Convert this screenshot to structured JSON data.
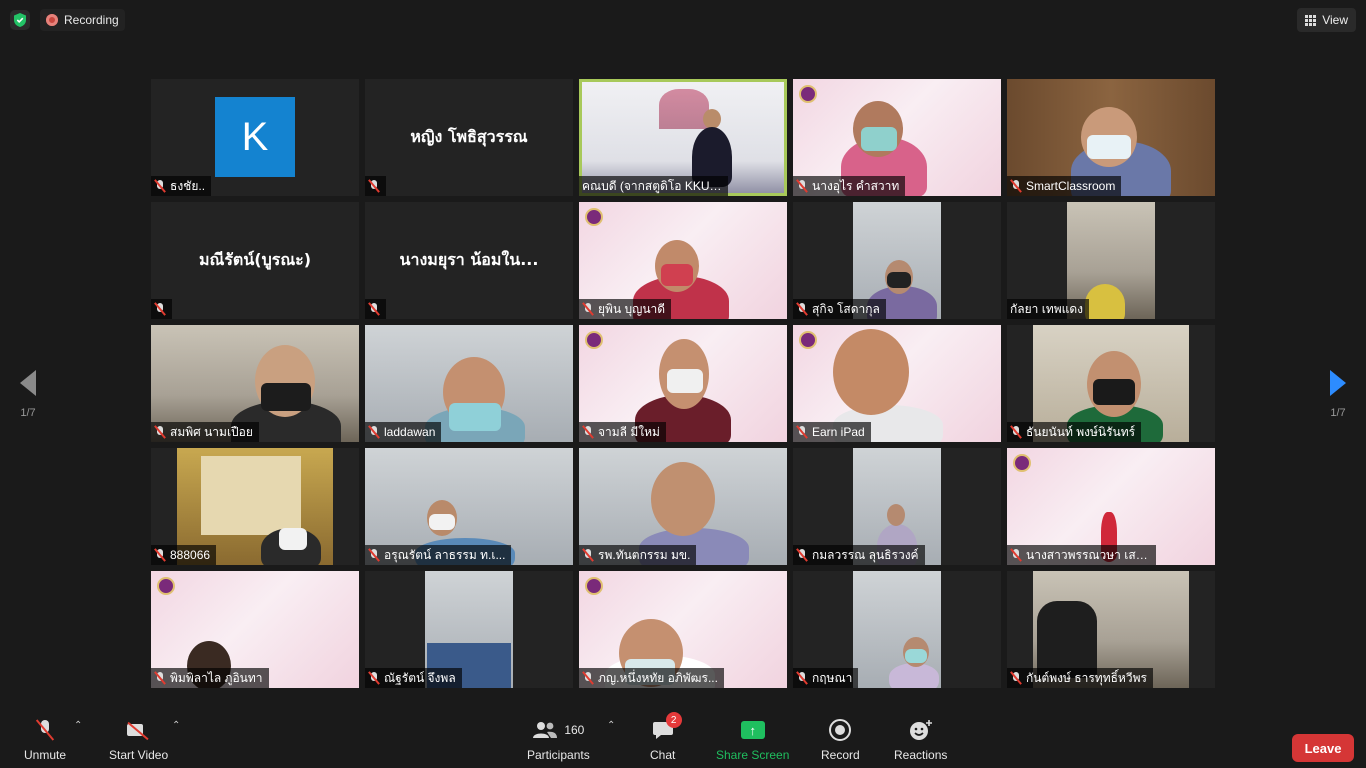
{
  "topbar": {
    "recording_label": "Recording",
    "view_label": "View"
  },
  "pagination": {
    "left": "1/7",
    "right": "1/7"
  },
  "tiles": [
    {
      "name": "ธงชัย..",
      "avatar": "K"
    },
    {
      "name": "",
      "big_name": "หญิง โพธิสุวรรณ"
    },
    {
      "name": "คณบดี (จากสตูดิโอ KKU ..."
    },
    {
      "name": "นางอุไร คำสวาท"
    },
    {
      "name": "SmartClassroom"
    },
    {
      "name": "",
      "big_name": "มณีรัตน์(บูรณะ)"
    },
    {
      "name": "",
      "big_name": "นางมยุรา น้อมใน..."
    },
    {
      "name": "ยุพิน บุญนาดี"
    },
    {
      "name": "สุกิจ โสดากุล"
    },
    {
      "name": "กัลยา เทพแดง"
    },
    {
      "name": "สมพิศ นามเปือย"
    },
    {
      "name": "laddawan"
    },
    {
      "name": "จามลี มีใหม่"
    },
    {
      "name": "Earn iPad"
    },
    {
      "name": "ธันยนันท์ พงษ์นิรันทร์"
    },
    {
      "name": "888066"
    },
    {
      "name": "อรุณรัตน์ ลาธรรม ท.เ..."
    },
    {
      "name": "รพ.ทันตกรรม มข."
    },
    {
      "name": "กมลวรรณ ลุนธิรวงค์"
    },
    {
      "name": "นางสาวพรรณวษา เสร..."
    },
    {
      "name": "พิมพิลาไล ภูอินทา"
    },
    {
      "name": "ณัฐรัตน์ จึงพล"
    },
    {
      "name": "ภญ.หนึ่งหทัย อภิพัฒร..."
    },
    {
      "name": "กฤษณา"
    },
    {
      "name": "กันต์พงษ์ ธารทุทธิ์หวีพร"
    }
  ],
  "bottombar": {
    "unmute": "Unmute",
    "start_video": "Start Video",
    "participants_count": "160",
    "participants": "Participants",
    "chat": "Chat",
    "chat_badge": "2",
    "share_screen": "Share Screen",
    "record": "Record",
    "reactions": "Reactions",
    "leave": "Leave"
  },
  "colors": {
    "background": "#1a1a1a",
    "tile_bg": "#232323",
    "active_speaker": "#a8c95a",
    "share_green": "#1fbf5f",
    "leave_red": "#d53636",
    "nav_arrow_active": "#2d8cff"
  }
}
